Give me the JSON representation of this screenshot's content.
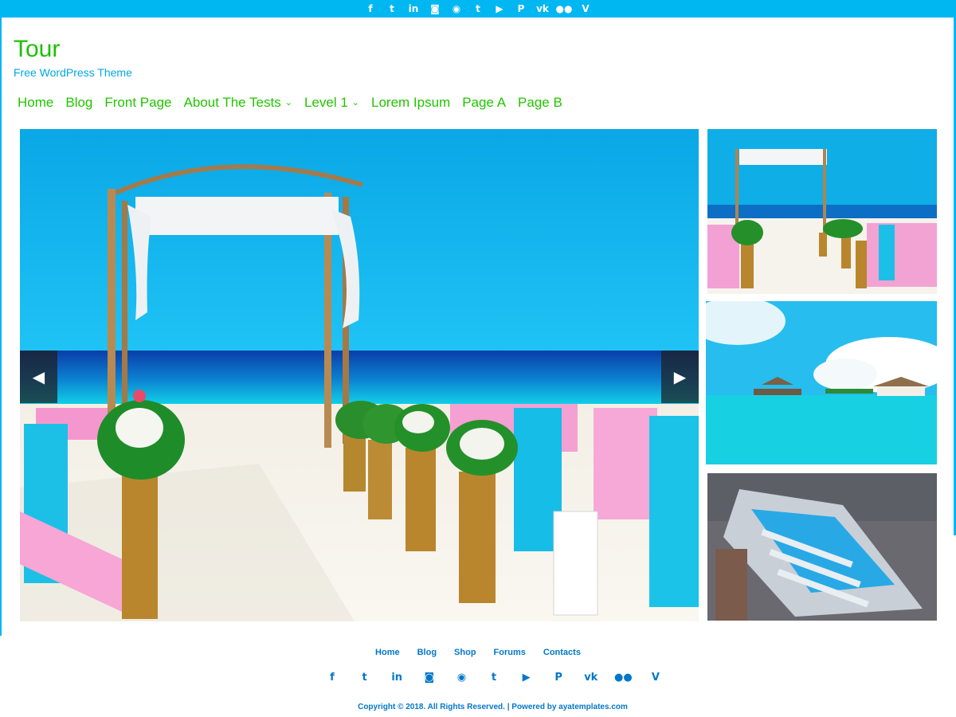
{
  "top_social": [
    {
      "name": "facebook",
      "glyph": "f"
    },
    {
      "name": "twitter",
      "glyph": "t"
    },
    {
      "name": "linkedin",
      "glyph": "in"
    },
    {
      "name": "instagram",
      "glyph": "◙"
    },
    {
      "name": "rss",
      "glyph": "◉"
    },
    {
      "name": "tumblr",
      "glyph": "t"
    },
    {
      "name": "youtube",
      "glyph": "▶"
    },
    {
      "name": "pinterest",
      "glyph": "P"
    },
    {
      "name": "vk",
      "glyph": "vk"
    },
    {
      "name": "flickr",
      "glyph": "●●"
    },
    {
      "name": "vine",
      "glyph": "V"
    }
  ],
  "site": {
    "title": "Tour",
    "description": "Free WordPress Theme"
  },
  "nav": {
    "items": [
      {
        "label": "Home",
        "has_dropdown": false
      },
      {
        "label": "Blog",
        "has_dropdown": false
      },
      {
        "label": "Front Page",
        "has_dropdown": false
      },
      {
        "label": "About The Tests",
        "has_dropdown": true
      },
      {
        "label": "Level 1",
        "has_dropdown": true
      },
      {
        "label": "Lorem Ipsum",
        "has_dropdown": false
      },
      {
        "label": "Page A",
        "has_dropdown": false
      },
      {
        "label": "Page B",
        "has_dropdown": false
      }
    ],
    "dropdown_glyph": "⌄"
  },
  "slider": {
    "prev_glyph": "◀",
    "next_glyph": "▶"
  },
  "footer": {
    "nav": [
      "Home",
      "Blog",
      "Shop",
      "Forums",
      "Contacts"
    ],
    "social": [
      {
        "name": "facebook",
        "glyph": "f"
      },
      {
        "name": "twitter",
        "glyph": "t"
      },
      {
        "name": "linkedin",
        "glyph": "in"
      },
      {
        "name": "instagram",
        "glyph": "◙"
      },
      {
        "name": "rss",
        "glyph": "◉"
      },
      {
        "name": "tumblr",
        "glyph": "t"
      },
      {
        "name": "youtube",
        "glyph": "▶"
      },
      {
        "name": "pinterest",
        "glyph": "P"
      },
      {
        "name": "vk",
        "glyph": "vk"
      },
      {
        "name": "flickr",
        "glyph": "●●"
      },
      {
        "name": "vine",
        "glyph": "V"
      }
    ],
    "copyright": "Copyright © 2018. All Rights Reserved. | Powered by ayatemplates.com"
  },
  "colors": {
    "accent_blue": "#00b7f1",
    "nav_green": "#22c500",
    "footer_blue": "#0277c9"
  }
}
